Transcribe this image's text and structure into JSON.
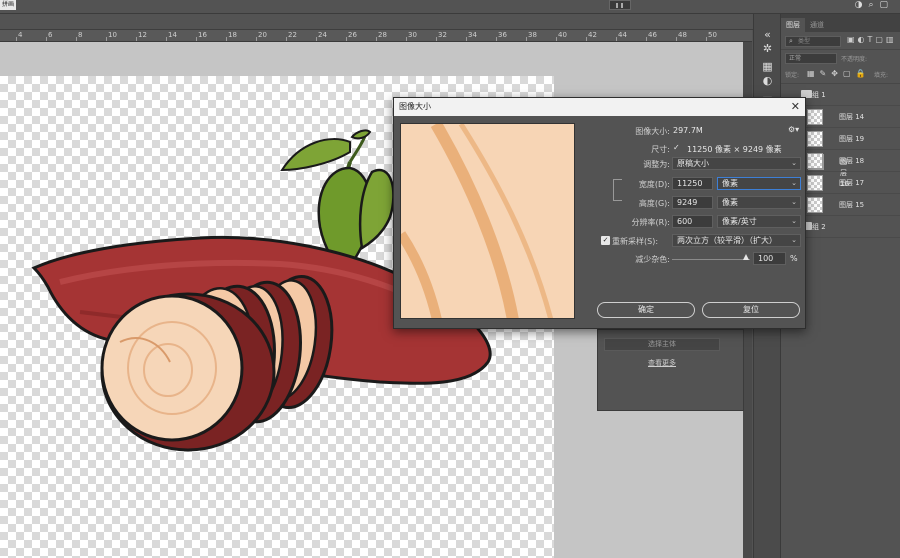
{
  "topbar": {
    "left_button": "拼画"
  },
  "ruler": {
    "ticks": [
      "4",
      "6",
      "8",
      "10",
      "12",
      "14",
      "16",
      "18",
      "20",
      "22",
      "24",
      "26",
      "28",
      "30",
      "32",
      "34",
      "36",
      "38",
      "40",
      "42",
      "44",
      "46",
      "48",
      "50"
    ]
  },
  "layers_panel": {
    "tabs": [
      "图层",
      "通道"
    ],
    "kind_placeholder": "类型",
    "blend_mode": "正常",
    "opacity_label": "不透明度:",
    "lock_label": "锁定:",
    "fill_label": "填充:",
    "layers": [
      {
        "name": "组 1",
        "type": "group",
        "selected": false
      },
      {
        "name": "图层 14",
        "type": "layer",
        "selected": false
      },
      {
        "name": "图层 19",
        "type": "layer",
        "selected": false
      },
      {
        "name": "图层 16",
        "type": "layer",
        "selected": true
      },
      {
        "name": "图层 18",
        "type": "layer",
        "selected": false
      },
      {
        "name": "图层 17",
        "type": "layer",
        "selected": false
      },
      {
        "name": "图层 15",
        "type": "layer",
        "selected": false
      },
      {
        "name": "组 2",
        "type": "group",
        "selected": false
      }
    ]
  },
  "background_panel": {
    "select_subject": "选择主体",
    "see_more": "查看更多"
  },
  "dialog": {
    "title": "图像大小",
    "image_size_label": "图像大小:",
    "image_size_value": "297.7M",
    "dimensions_label": "尺寸:",
    "dimensions_value": "11250 像素 × 9249 像素",
    "fit_to_label": "调整为:",
    "fit_to_value": "原稿大小",
    "width_label": "宽度(D):",
    "width_value": "11250",
    "width_unit": "像素",
    "height_label": "高度(G):",
    "height_value": "9249",
    "height_unit": "像素",
    "resolution_label": "分辨率(R):",
    "resolution_value": "600",
    "resolution_unit": "像素/英寸",
    "resample_label": "重新采样(S):",
    "resample_checked": true,
    "resample_value": "两次立方（较平滑）（扩大）",
    "noise_label": "减少杂色:",
    "noise_value": "100",
    "noise_unit": "%",
    "ok_label": "确定",
    "reset_label": "复位"
  }
}
